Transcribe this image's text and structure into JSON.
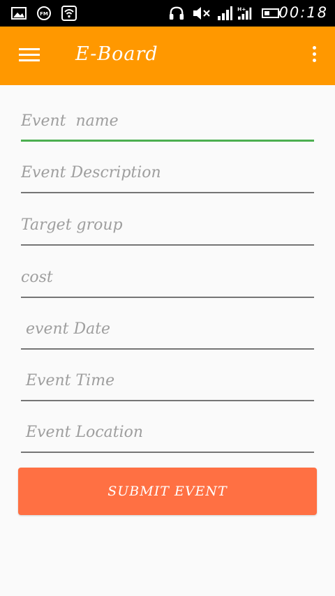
{
  "status_bar": {
    "time": "00:18",
    "icons": [
      "image-icon",
      "fm-radio-icon",
      "wifi-icon",
      "headphones-icon",
      "mute-icon",
      "signal-icon",
      "signal-hplus-icon",
      "battery-icon"
    ]
  },
  "app_bar": {
    "title": "E-Board",
    "menu_icon": "hamburger-menu-icon",
    "overflow_icon": "more-vert-icon",
    "color": "#ff9800"
  },
  "form": {
    "event_name_placeholder": "Event  name",
    "event_description_placeholder": "Event Description",
    "target_group_placeholder": "Target group",
    "cost_placeholder": "cost",
    "event_date_placeholder": " event Date",
    "event_time_placeholder": " Event Time",
    "event_location_placeholder": " Event Location",
    "focus_color": "#4caf50"
  },
  "submit_button": {
    "label": "SUBMIT EVENT",
    "color": "#ff7043"
  }
}
